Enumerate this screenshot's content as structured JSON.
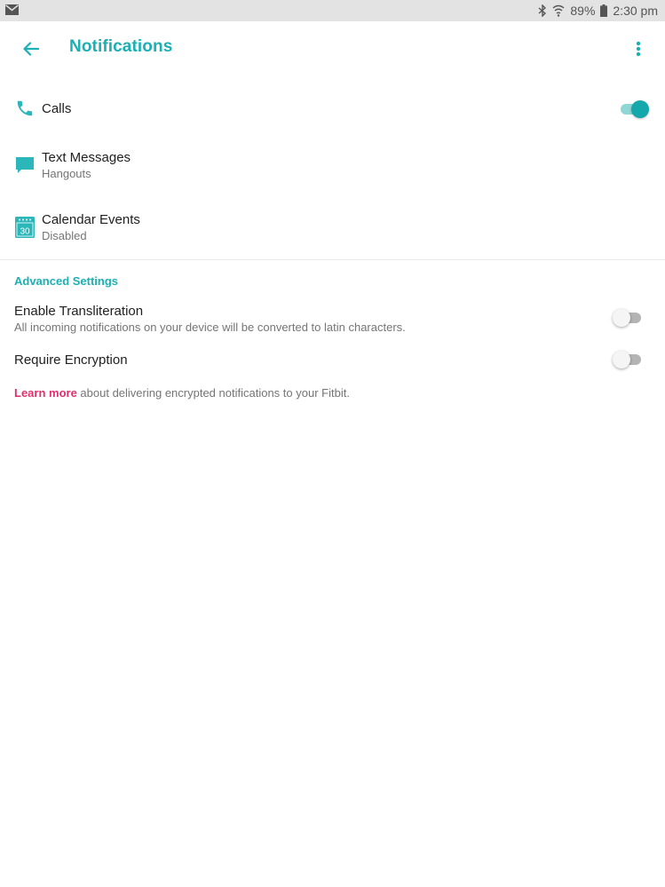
{
  "status_bar": {
    "battery": "89%",
    "time": "2:30 pm"
  },
  "header": {
    "title": "Notifications"
  },
  "notifications": [
    {
      "title": "Calls",
      "subtitle": "",
      "icon": "phone-icon",
      "enabled": true
    },
    {
      "title": "Text Messages",
      "subtitle": "Hangouts",
      "icon": "message-icon"
    },
    {
      "title": "Calendar Events",
      "subtitle": "Disabled",
      "icon": "calendar-icon",
      "icon_text": "30"
    }
  ],
  "advanced": {
    "header": "Advanced Settings",
    "transliteration": {
      "title": "Enable Transliteration",
      "description": "All incoming notifications on your device will be converted to latin characters.",
      "enabled": false
    },
    "encryption": {
      "title": "Require Encryption",
      "enabled": false
    },
    "learn_more": {
      "link": "Learn more",
      "text": " about delivering encrypted notifications to your Fitbit."
    }
  },
  "colors": {
    "accent": "#1bb0b3",
    "link": "#e0306a",
    "toggle_on": "#14a8ad"
  }
}
